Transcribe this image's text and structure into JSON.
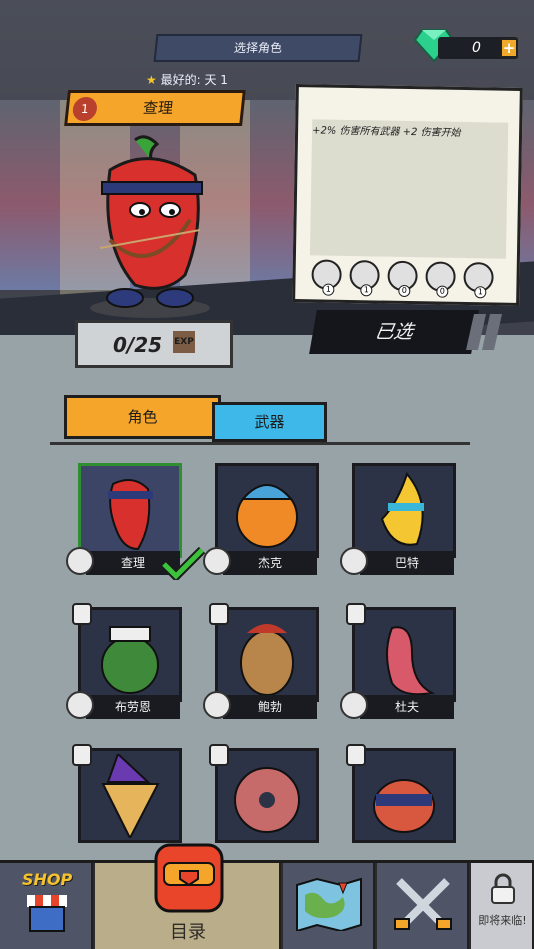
{
  "header": {
    "title": "选择角色",
    "gems": "0",
    "plus_label": "+",
    "favorite_label": "最好的:",
    "favorite_value": "天 1"
  },
  "hero": {
    "level": "1",
    "name": "查理",
    "exp": "0/25",
    "exp_icon": "EXP",
    "description": "+2% 伤害所有武器 +2 伤害开始",
    "stats": [
      {
        "icon": "zombie-face-icon",
        "value": "1"
      },
      {
        "icon": "knife-icon",
        "value": "1"
      },
      {
        "icon": "wizard-hat-icon",
        "value": "0"
      },
      {
        "icon": "arrow-up-icon",
        "value": "0"
      },
      {
        "icon": "meat-icon",
        "value": "1"
      }
    ],
    "selected_label": "已选"
  },
  "tabs": {
    "roles": "角色",
    "weapons": "武器"
  },
  "characters": [
    {
      "name": "查理",
      "badge": "knife-icon",
      "locked": false,
      "active": true,
      "color": "#d8302c"
    },
    {
      "name": "杰克",
      "badge": "meat-icon",
      "locked": false,
      "active": false,
      "color": "#f08a26"
    },
    {
      "name": "巴特",
      "badge": "zombie-face-icon",
      "locked": false,
      "active": false,
      "color": "#f4c631"
    },
    {
      "name": "布劳恩",
      "badge": "meat-icon",
      "locked": true,
      "active": false,
      "color": "#3f8a3a"
    },
    {
      "name": "鲍勃",
      "badge": "knife-icon",
      "locked": true,
      "active": false,
      "color": "#b8864a"
    },
    {
      "name": "杜夫",
      "badge": "zombie-face-icon",
      "locked": true,
      "active": false,
      "color": "#d8596a"
    },
    {
      "name": "",
      "badge": "",
      "locked": true,
      "active": false,
      "color": "#e6b45a"
    },
    {
      "name": "",
      "badge": "",
      "locked": true,
      "active": false,
      "color": "#c76a6a"
    },
    {
      "name": "",
      "badge": "",
      "locked": true,
      "active": false,
      "color": "#d8573f"
    }
  ],
  "nav": {
    "shop": "SHOP",
    "catalog": "目录",
    "coming_soon": "即将来临!"
  }
}
